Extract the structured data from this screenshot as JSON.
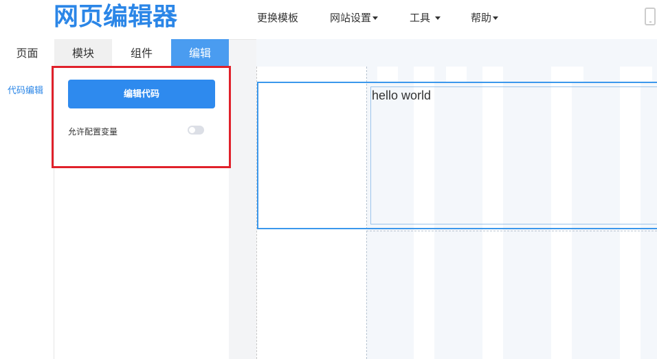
{
  "header": {
    "logo": "网页编辑器",
    "nav": [
      {
        "label": "更换模板"
      },
      {
        "label": "网站设置"
      },
      {
        "label": "工具"
      },
      {
        "label": "帮助"
      }
    ]
  },
  "tabs": [
    {
      "label": "页面"
    },
    {
      "label": "模块"
    },
    {
      "label": "组件"
    },
    {
      "label": "编辑"
    }
  ],
  "leftnav": {
    "item": "代码编辑"
  },
  "panel": {
    "button_label": "编辑代码",
    "toggle_label": "允许配置变量",
    "toggle_on": false
  },
  "canvas": {
    "text": "hello world"
  },
  "colors": {
    "accent": "#2e8aee",
    "highlight": "#e0202a"
  }
}
